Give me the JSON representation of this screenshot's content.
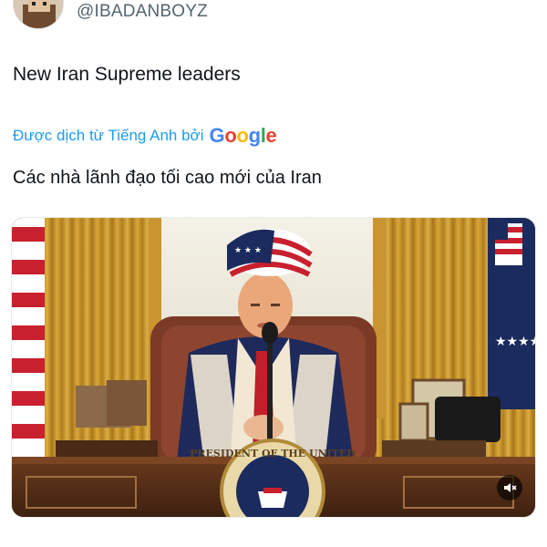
{
  "author": {
    "handle": "@IBADANBOYZ",
    "avatar_icon": "avatar-icon"
  },
  "tweet": {
    "text": "New Iran Supreme leaders"
  },
  "translation": {
    "label": "Được dịch từ Tiếng Anh bởi",
    "provider": "Google",
    "text": "Các nhà lãnh đạo tối cao mới của Iran"
  },
  "media": {
    "type": "image",
    "seal_text": "PRESIDENT OF THE UNITED",
    "mute_icon": "speaker-muted-icon"
  },
  "colors": {
    "link_blue": "#1d9bf0",
    "secondary_text": "#536471"
  }
}
